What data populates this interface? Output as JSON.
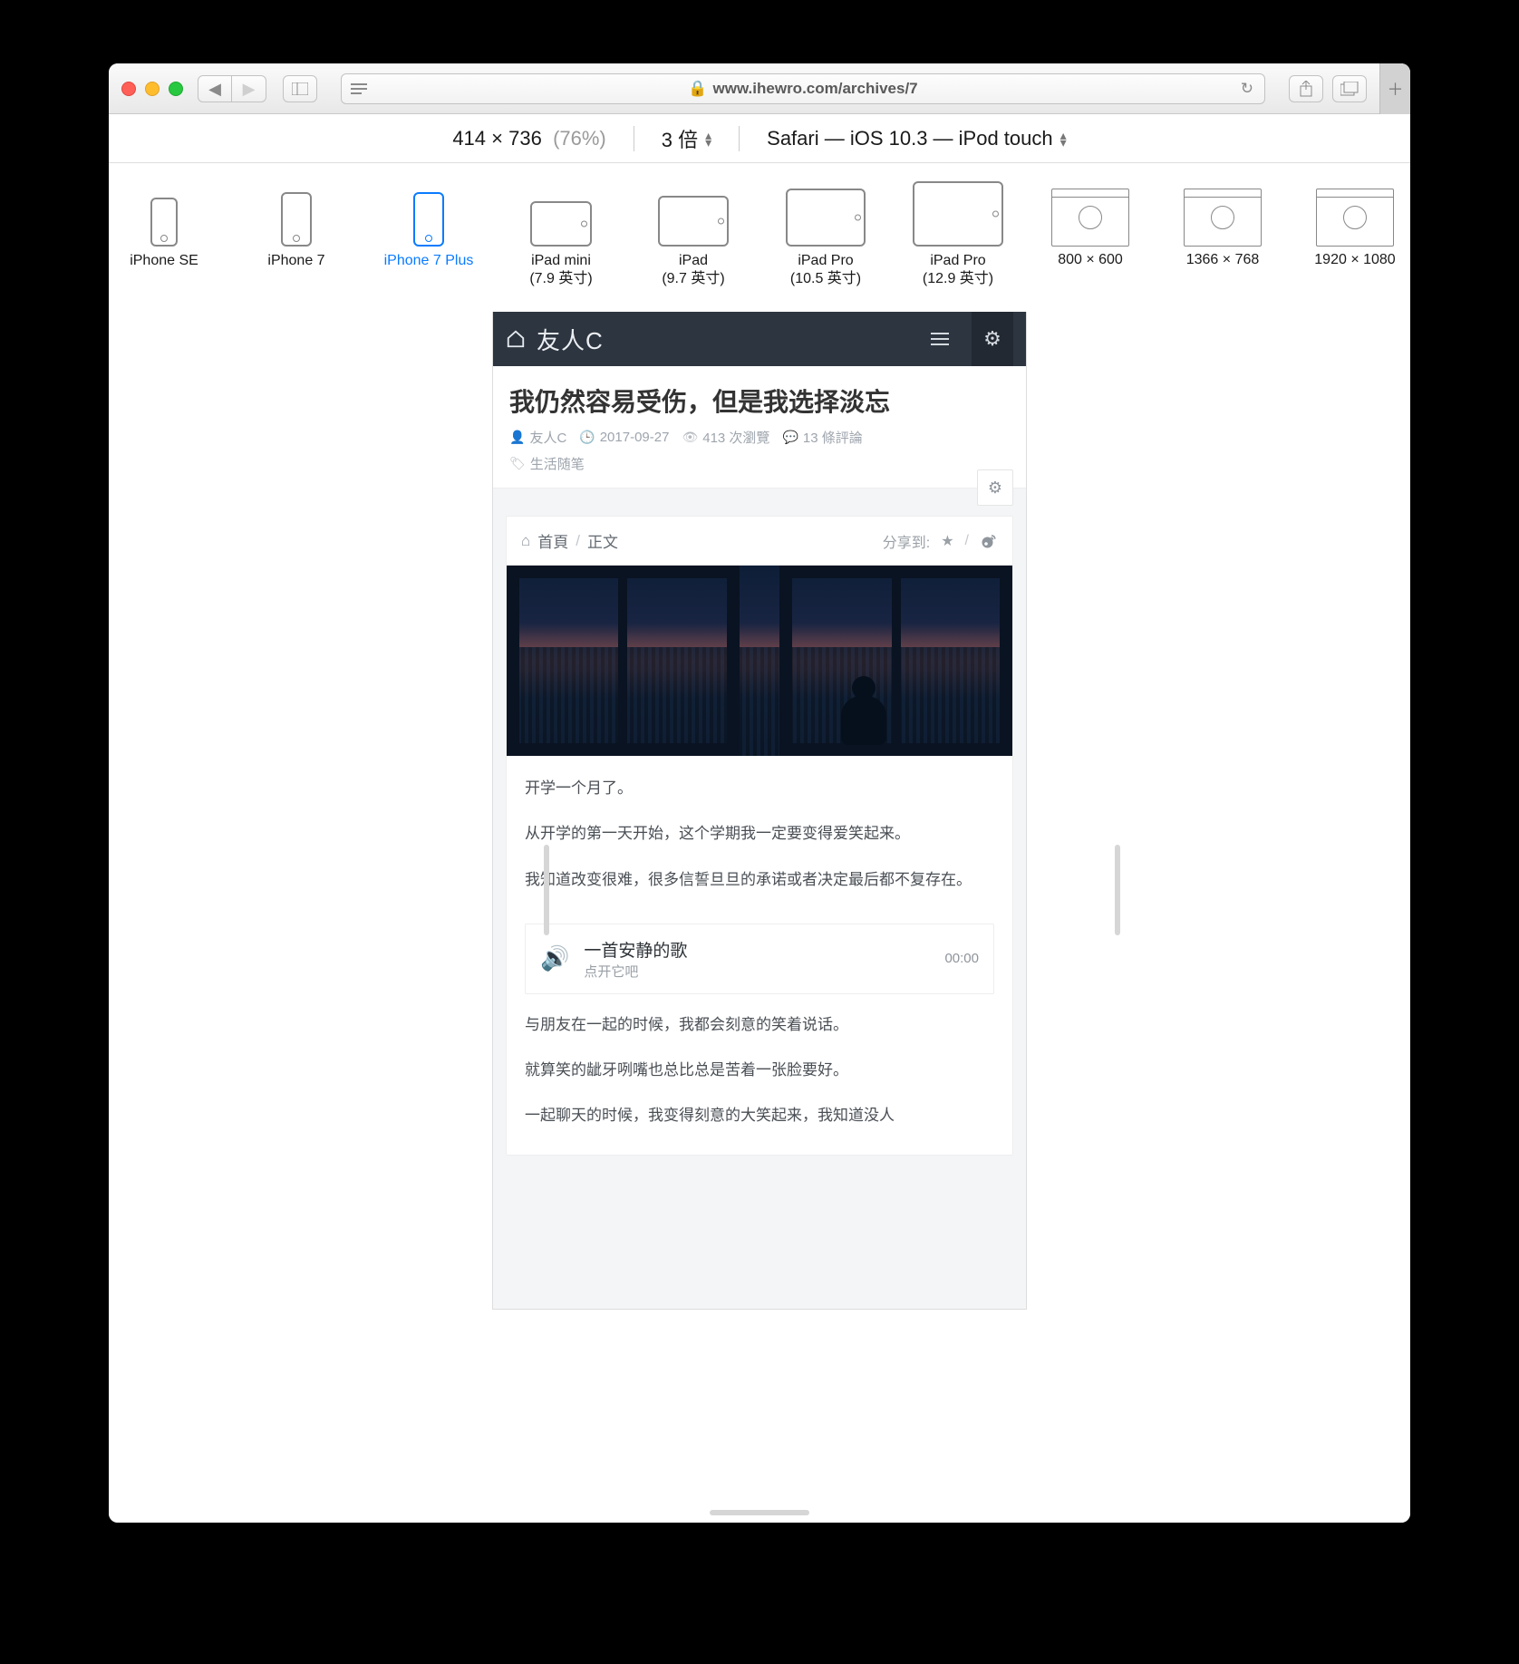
{
  "browser": {
    "url_display": "www.ihewro.com/archives/7"
  },
  "rdm": {
    "width": "414",
    "height": "736",
    "percent": "(76%)",
    "zoom_label": "3 倍",
    "agent_label": "Safari — iOS 10.3 — iPod touch"
  },
  "devices": [
    {
      "name": "iPhone SE"
    },
    {
      "name": "iPhone 7"
    },
    {
      "name": "iPhone 7 Plus"
    },
    {
      "name": "iPad mini",
      "sub": "(7.9 英寸)"
    },
    {
      "name": "iPad",
      "sub": "(9.7 英寸)"
    },
    {
      "name": "iPad Pro",
      "sub": "(10.5 英寸)"
    },
    {
      "name": "iPad Pro",
      "sub": "(12.9 英寸)"
    },
    {
      "name": "800 × 600"
    },
    {
      "name": "1366 × 768"
    },
    {
      "name": "1920 × 1080"
    }
  ],
  "site": {
    "brand": "友人C",
    "post_title": "我仍然容易受伤，但是我选择淡忘",
    "author": "友人C",
    "date": "2017-09-27",
    "views": "413 次瀏覽",
    "comments": "13 條評論",
    "tag": "生活随笔",
    "breadcrumb_home": "首頁",
    "breadcrumb_current": "正文",
    "share_label": "分享到:",
    "player_title": "一首安静的歌",
    "player_sub": "点开它吧",
    "player_time": "00:00",
    "paragraphs": [
      "开学一个月了。",
      "从开学的第一天开始，这个学期我一定要变得爱笑起来。",
      "我知道改变很难，很多信誓旦旦的承诺或者决定最后都不复存在。",
      "与朋友在一起的时候，我都会刻意的笑着说话。",
      "就算笑的龇牙咧嘴也总比总是苦着一张脸要好。",
      "一起聊天的时候，我变得刻意的大笑起来，我知道没人"
    ]
  }
}
